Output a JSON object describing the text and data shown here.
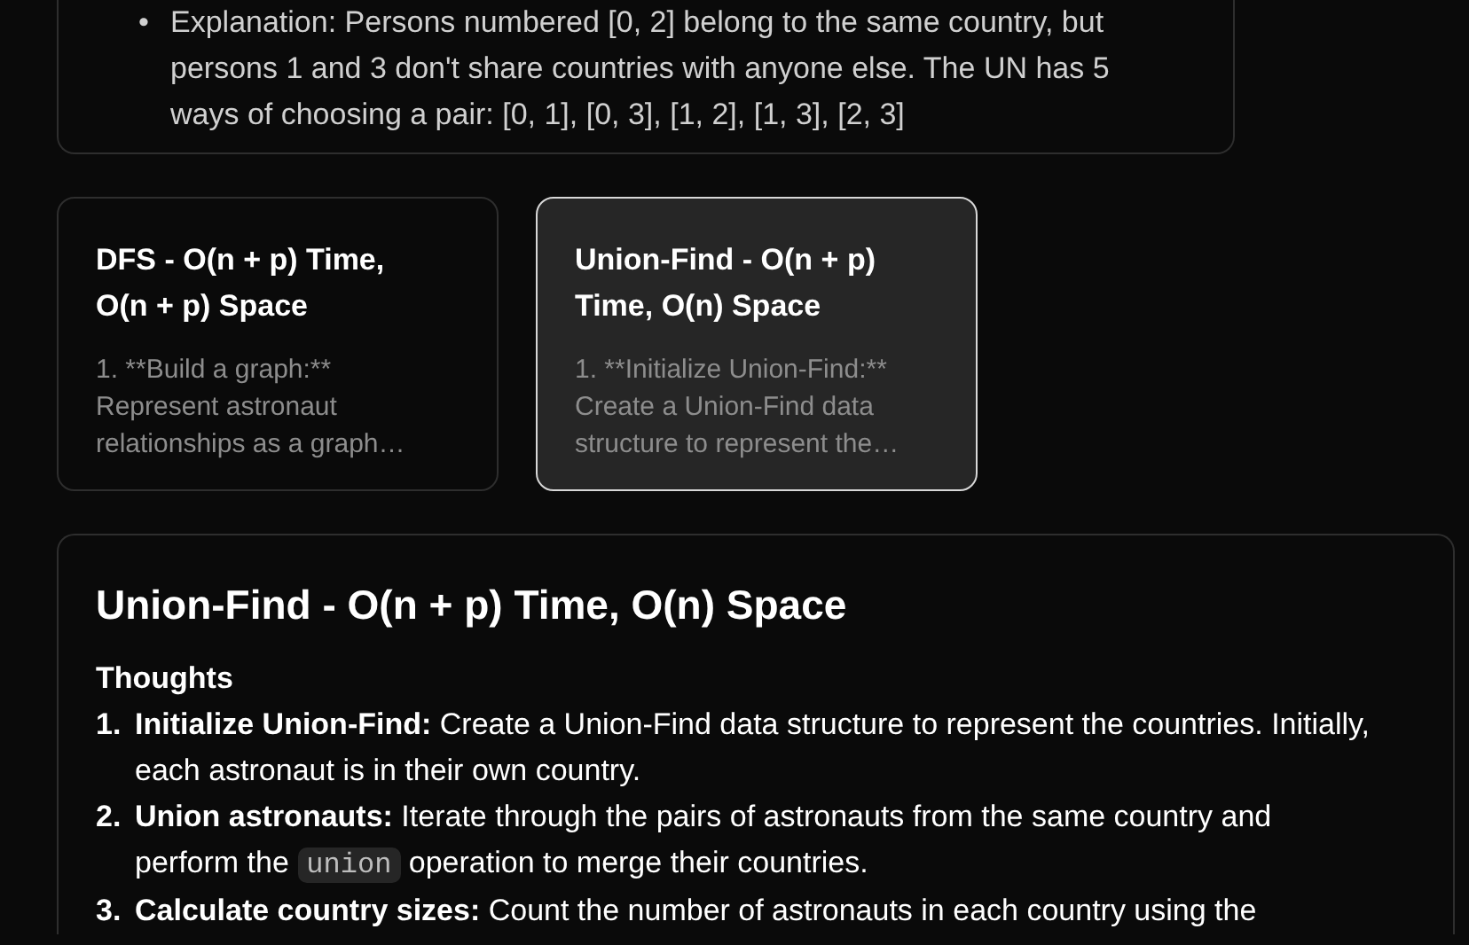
{
  "example": {
    "bullets": [
      {
        "marker": "•",
        "text": "Explanation: Persons numbered [0, 2] belong to the same country, but persons 1 and 3 don't share countries with anyone else. The UN has 5 ways of choosing a pair: [0, 1], [0, 3], [1, 2], [1, 3], [2, 3]"
      }
    ]
  },
  "approaches": [
    {
      "title": "DFS - O(n + p) Time, O(n + p) Space",
      "preview": "1. **Build a graph:** Represent astronaut relationships as a graph…",
      "selected": false
    },
    {
      "title": "Union-Find - O(n + p) Time, O(n) Space",
      "preview": "1. **Initialize Union-Find:** Create a Union-Find data structure to represent the…",
      "selected": true
    }
  ],
  "detail": {
    "title": "Union-Find - O(n + p) Time, O(n) Space",
    "section": "Thoughts",
    "steps": [
      {
        "number": "1.",
        "parts": [
          {
            "kind": "text",
            "text": "**Initialize Union-Find:** Create a Union-Find data structure to represent the countries. Initially, each astronaut is in their own country."
          }
        ]
      },
      {
        "number": "2.",
        "parts": [
          {
            "kind": "text",
            "text": "**Union astronauts:** Iterate through the pairs of astronauts from the same country and perform the "
          },
          {
            "kind": "code",
            "text": "union"
          },
          {
            "kind": "text",
            "text": " operation to merge their countries."
          }
        ]
      },
      {
        "number": "3.",
        "parts": [
          {
            "kind": "text",
            "text": "**Calculate country sizes:** Count the number of astronauts in each country using the"
          }
        ]
      }
    ]
  }
}
